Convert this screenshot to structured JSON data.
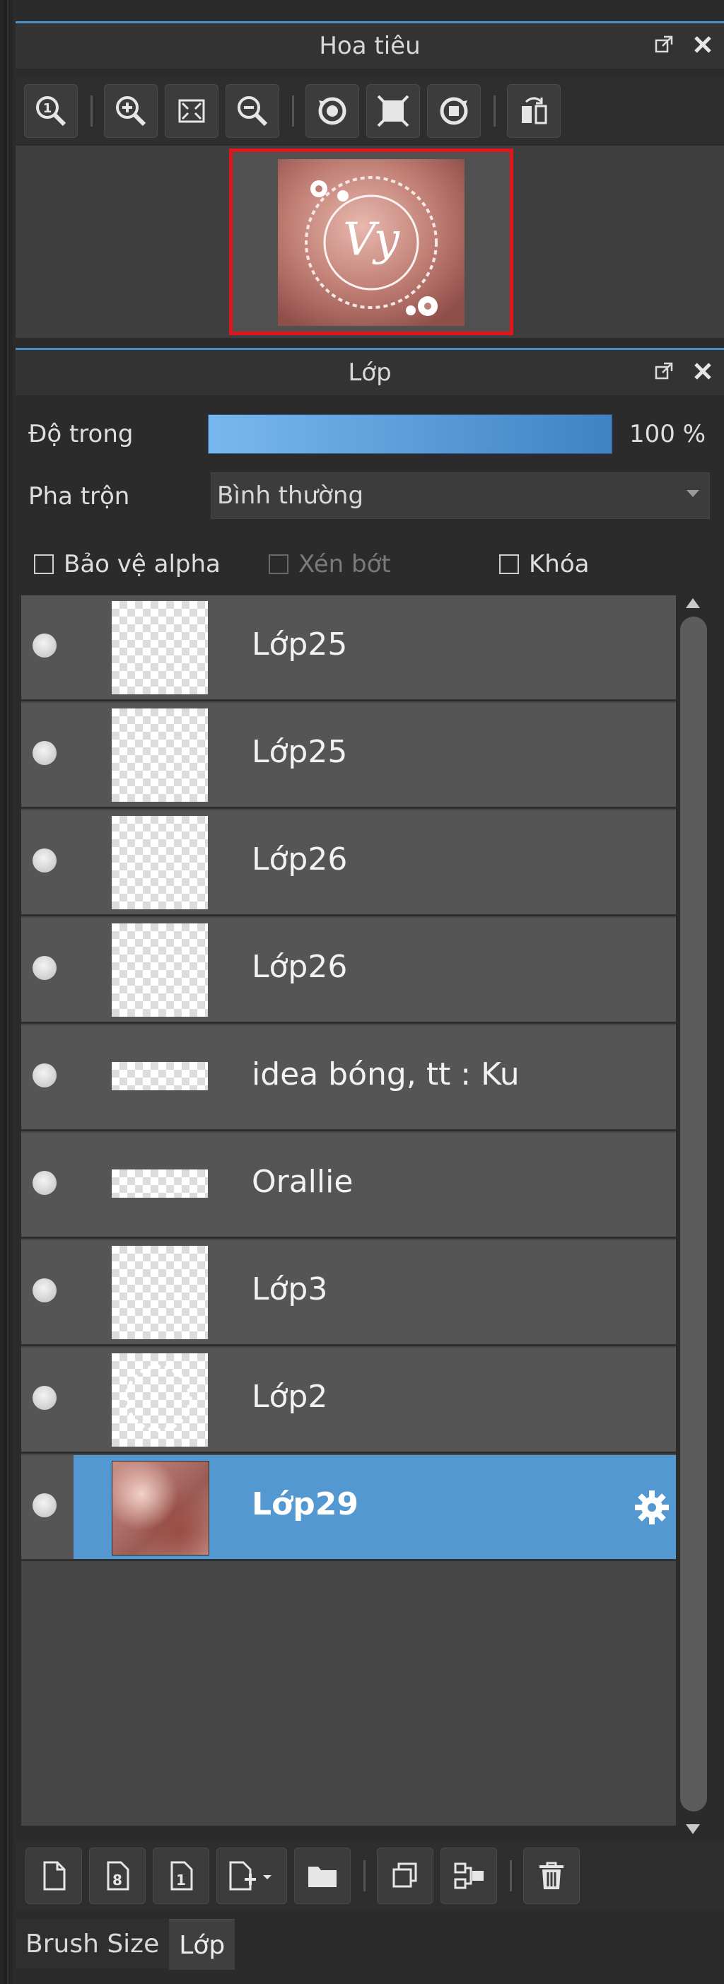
{
  "navigator": {
    "title": "Hoa tiêu",
    "icons": [
      "zoom-actual-icon",
      "zoom-in-icon",
      "fit-screen-icon",
      "zoom-out-icon",
      "rotate-left-icon",
      "fit-canvas-icon",
      "rotate-right-icon",
      "flip-horizontal-icon"
    ]
  },
  "layers_panel": {
    "title": "Lớp",
    "opacity_label": "Độ trong",
    "opacity_value": "100 %",
    "opacity_level": 1.0,
    "blend_label": "Pha trộn",
    "blend_value": "Bình thường",
    "protect_alpha": "Bảo vệ alpha",
    "clipping": "Xén bớt",
    "lock": "Khóa"
  },
  "layers": [
    {
      "name": "Lớp25",
      "thumb": "transparent",
      "selected": false
    },
    {
      "name": "Lớp25",
      "thumb": "transparent",
      "selected": false
    },
    {
      "name": "Lớp26",
      "thumb": "transparent",
      "selected": false
    },
    {
      "name": "Lớp26",
      "thumb": "transparent",
      "selected": false
    },
    {
      "name": "idea bóng, tt : Ku",
      "thumb": "wide",
      "selected": false
    },
    {
      "name": "Orallie",
      "thumb": "wide",
      "selected": false
    },
    {
      "name": "Lớp3",
      "thumb": "transparent",
      "selected": false
    },
    {
      "name": "Lớp2",
      "thumb": "ring",
      "selected": false
    },
    {
      "name": "Lớp29",
      "thumb": "photo",
      "selected": true
    }
  ],
  "bottom_toolbar": {
    "icons": [
      "new-layer-icon",
      "new-8bit-layer-icon",
      "new-1bit-layer-icon",
      "add-layer-menu-icon",
      "new-folder-icon",
      "duplicate-layer-icon",
      "merge-down-icon",
      "delete-layer-icon"
    ]
  },
  "tabs": [
    "Brush Size",
    "Lớp"
  ],
  "colors": {
    "accent": "#4a8fc5",
    "selection": "#5398d0",
    "navigator_frame": "#e0161c"
  }
}
